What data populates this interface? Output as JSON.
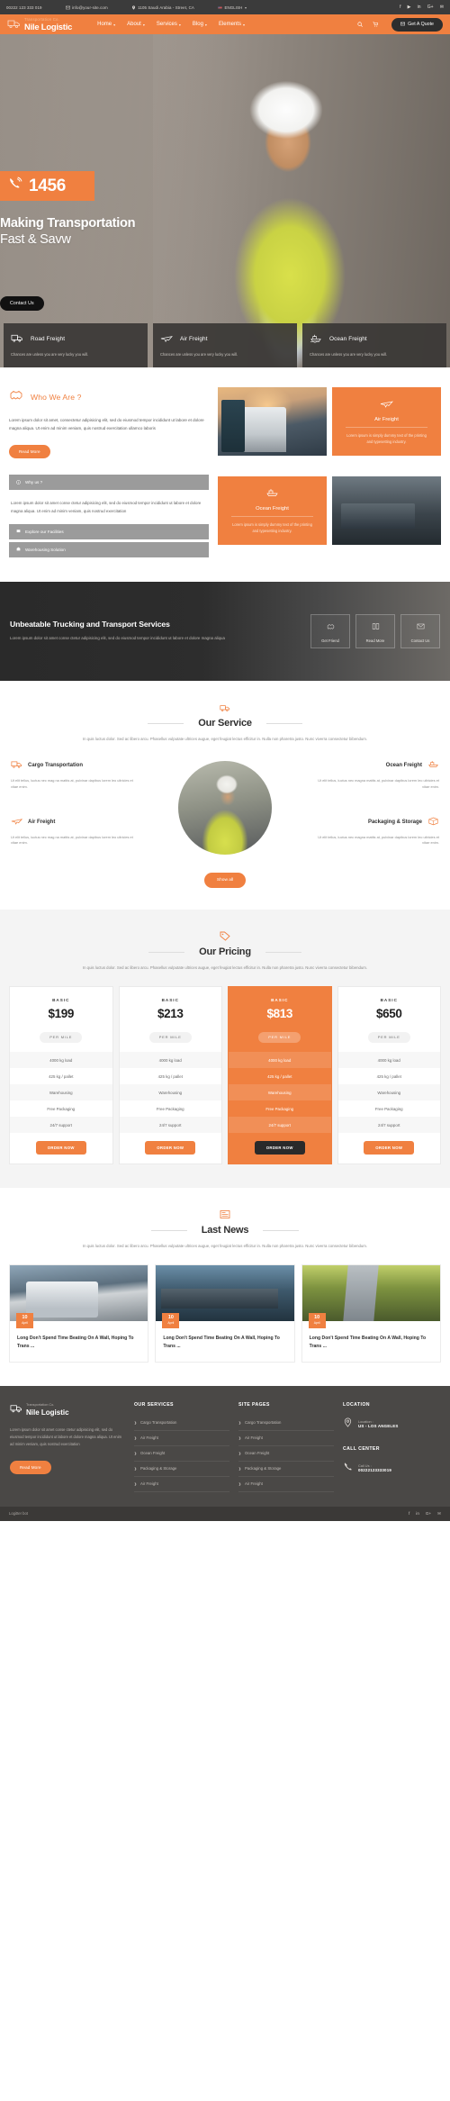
{
  "topbar": {
    "phone": "00222 123 333 019",
    "email": "info@your-site.com",
    "address": "1105 Saudi Arabia - Street, CA",
    "language": "ENGLISH",
    "social": [
      "f",
      "▶",
      "in",
      "G+",
      "✉"
    ]
  },
  "nav": {
    "brand_sub": "Transportation Co.",
    "brand_name": "Nile Logistic",
    "links": [
      {
        "label": "Home",
        "caret": "▾"
      },
      {
        "label": "About",
        "caret": "▾"
      },
      {
        "label": "Services",
        "caret": "▾"
      },
      {
        "label": "Blog",
        "caret": "▾"
      },
      {
        "label": "Elements",
        "caret": "▾"
      }
    ],
    "quote_label": "Get A Quote"
  },
  "hero": {
    "phone_number": "1456",
    "title_line1": "Making Transportation",
    "title_line2": "Fast & Savw",
    "cta_label": "Contact Us"
  },
  "freight": [
    {
      "title": "Road Freight",
      "desc": "Chances are unless you are very lucky you will."
    },
    {
      "title": "Air Freight",
      "desc": "Chances are unless you are very lucky you will."
    },
    {
      "title": "Ocean Freight",
      "desc": "Chances are unless you are very lucky you will."
    }
  ],
  "who": {
    "heading": "Who We Are ?",
    "paragraph": "Lorem ipsum dolor sit amet, consectetur adipisicing elit, sed do eiusmod tempor incididunt ut labore et dolore magna aliqua. Ut enim ad minim veniam, quis nostrud exercitation ullamco laboris",
    "read_more": "Read More",
    "accordion_title": "Why us ?",
    "accordion_body": "Lorem ipsum dolor sit amet conse ctetur adipisicing elit, sed do eiusmod tempor incididunt ut labore et dolore magna aliqua. Ut enim ad minim veniam, quis nostrud exercitation",
    "accordion_items": [
      "Explore our Facilities",
      "Warehousing Solution"
    ],
    "cards": [
      {
        "title": "Air Freight",
        "desc": "Lorem ipsum is simply dummy text of the printing and typesetting industry."
      },
      {
        "title": "Ocean Freight",
        "desc": "Lorem ipsum is simply dummy text of the printing and typesetting industry."
      }
    ]
  },
  "banner": {
    "title": "Unbeatable Trucking and Transport Services",
    "paragraph": "Lorem ipsum dolor sit amet conse ctetur adipisicing elit, sed do eiusmod tempor incididunt ut labore et dolore magna aliqua",
    "boxes": [
      {
        "label": "Get Friend",
        "icon": "handshake-icon"
      },
      {
        "label": "Read More",
        "icon": "book-icon"
      },
      {
        "label": "Contact Us",
        "icon": "envelope-icon"
      }
    ]
  },
  "service": {
    "title": "Our Service",
    "subtitle": "In quis luctus dolor. Sed ac libero arcu. Phasellus vulputate ultrices augue, eget feugiat lectus efficitur in. Nulla non pharetra justo. Nunc viverra consectetur bibendum.",
    "items_left": [
      {
        "title": "Cargo Transportation",
        "desc": "Ut elit tellus, luctus nec mag na mattis at, pulvinar dapibus lorem leo ultricies et vitae enim."
      },
      {
        "title": "Air Freight",
        "desc": "Ut elit tellus, luctus nec mag na mattis at, pulvinar dapibus lorem leo ultricies et vitae enim."
      }
    ],
    "items_right": [
      {
        "title": "Ocean Freight",
        "desc": "Ut elit tellus, luctus nec magna mattis at, pulvinar dapibus lorem leo ultricies et vitae enim."
      },
      {
        "title": "Packaging & Storage",
        "desc": "Ut elit tellus, luctus nec magna mattis at, pulvinar dapibus lorem leo ultricies et vitae enim."
      }
    ],
    "show_all": "Show all"
  },
  "pricing": {
    "title": "Our Pricing",
    "subtitle": "In quis luctus dolor. Sed ac libero arcu. Phasellus vulputate ultrices augue, eget feugiat lectus efficitur in. Nulla non pharetra justo. Nunc viverra consectetur bibendum.",
    "plans": [
      {
        "plan": "BASIC",
        "price": "$199",
        "per": "PER MILE",
        "features": [
          "4000 kg load",
          "425 kg / pallet",
          "Warehousing",
          "Free Packaging",
          "24/7 support"
        ],
        "cta": "ORDER NOW",
        "featured": false
      },
      {
        "plan": "BASIC",
        "price": "$213",
        "per": "PER MILE",
        "features": [
          "4000 kg load",
          "425 kg / pallet",
          "Warehousing",
          "Free Packaging",
          "24/7 support"
        ],
        "cta": "ORDER NOW",
        "featured": false
      },
      {
        "plan": "BASIC",
        "price": "$813",
        "per": "PER MILE",
        "features": [
          "4000 kg load",
          "425 kg / pallet",
          "Warehousing",
          "Free Packaging",
          "24/7 support"
        ],
        "cta": "ORDER NOW",
        "featured": true
      },
      {
        "plan": "BASIC",
        "price": "$650",
        "per": "PER MILE",
        "features": [
          "4000 kg load",
          "425 kg / pallet",
          "Warehousing",
          "Free Packaging",
          "24/7 support"
        ],
        "cta": "ORDER NOW",
        "featured": false
      }
    ]
  },
  "news": {
    "title": "Last News",
    "subtitle": "In quis luctus dolor. Sed ac libero arcu. Phasellus vulputate ultrices augue, eget feugiat lectus efficitur in. Nulla non pharetra justo. Nunc viverra consectetur bibendum.",
    "posts": [
      {
        "day": "10",
        "month": "April",
        "title": "Long Don't Spend Time Beating On A Wall, Hoping To Trans ..."
      },
      {
        "day": "10",
        "month": "April",
        "title": "Long Don't Spend Time Beating On A Wall, Hoping To Trans ..."
      },
      {
        "day": "10",
        "month": "April",
        "title": "Long Don't Spend Time Beating On A Wall, Hoping To Trans ..."
      }
    ]
  },
  "footer": {
    "brand_sub": "Transportation Co.",
    "brand_name": "Nile Logistic",
    "about": "Lorem ipsum dolor sit amet conse ctetur adipisicing elit, sed do eiusmod tempor incididunt ut labore et dolore magna aliqua. Ut enim ad minim veniam, quis nostrud exercitation",
    "read_more": "Read More",
    "services_heading": "OUR SERVICES",
    "services": [
      "Cargo Transportation",
      "Air Freight",
      "Ocean Freight",
      "Packaging & Storage",
      "Air Freight"
    ],
    "pages_heading": "SITE PAGES",
    "pages": [
      "Cargo Transportation",
      "Air Freight",
      "Ocean Freight",
      "Packaging & Storage",
      "Air Freight"
    ],
    "location_heading": "LOCATION",
    "location_label": "Location :",
    "location_value": "US - LOS ANGELES",
    "call_heading": "CALL CENTER",
    "call_label": "Call Us :",
    "call_value": "00222123333019"
  },
  "bottombar": {
    "text": "Logitter bot",
    "social": [
      "f",
      "in",
      "G+",
      "✉"
    ]
  },
  "colors": {
    "accent": "#f08040",
    "dark": "#3b3b3b",
    "footer": "#4a4846"
  }
}
